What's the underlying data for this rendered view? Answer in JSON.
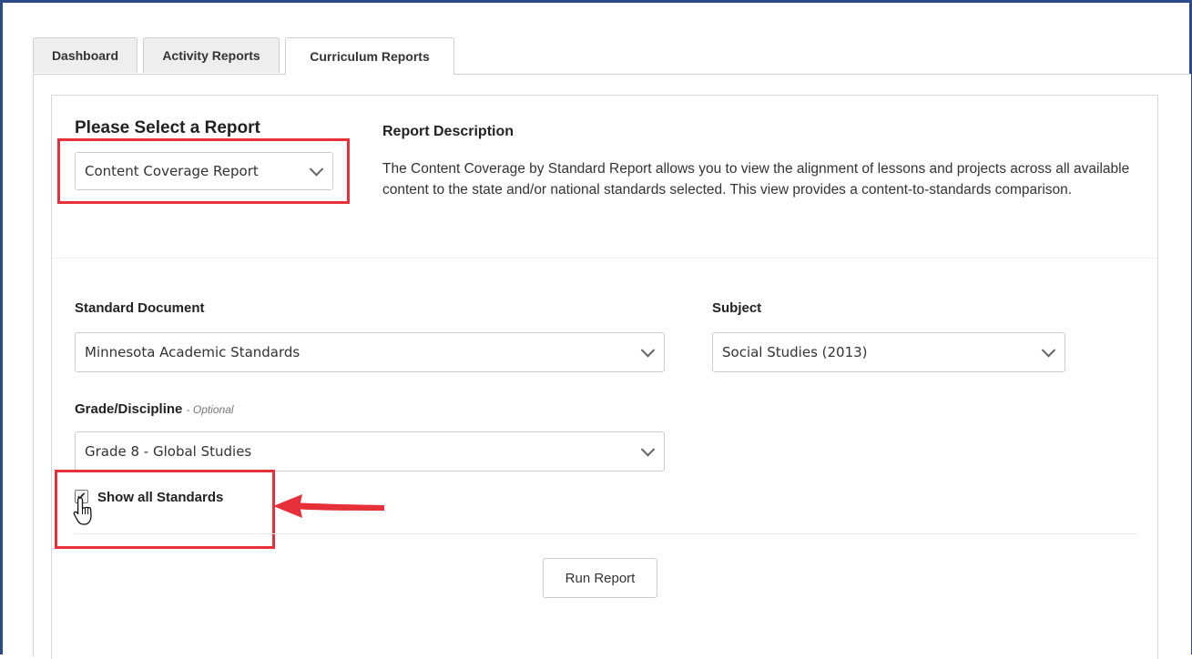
{
  "tabs": [
    {
      "label": "Dashboard",
      "active": false
    },
    {
      "label": "Activity Reports",
      "active": false
    },
    {
      "label": "Curriculum Reports",
      "active": true
    }
  ],
  "report_select": {
    "title": "Please Select a Report",
    "value": "Content Coverage Report"
  },
  "report_description": {
    "title": "Report Description",
    "text": "The Content Coverage by Standard Report allows you to view the alignment of lessons and projects across all available content to the state and/or national standards selected. This view provides a content-to-standards comparison."
  },
  "standard_document": {
    "label": "Standard Document",
    "value": "Minnesota Academic Standards"
  },
  "subject": {
    "label": "Subject",
    "value": "Social Studies (2013)"
  },
  "grade": {
    "label": "Grade/Discipline",
    "optional_label": "- Optional",
    "value": "Grade 8 - Global Studies"
  },
  "show_all_standards": {
    "label": "Show all Standards",
    "checked": true
  },
  "run_button": {
    "label": "Run Report"
  },
  "colors": {
    "highlight": "#e6303a",
    "frame": "#2a4a88"
  }
}
